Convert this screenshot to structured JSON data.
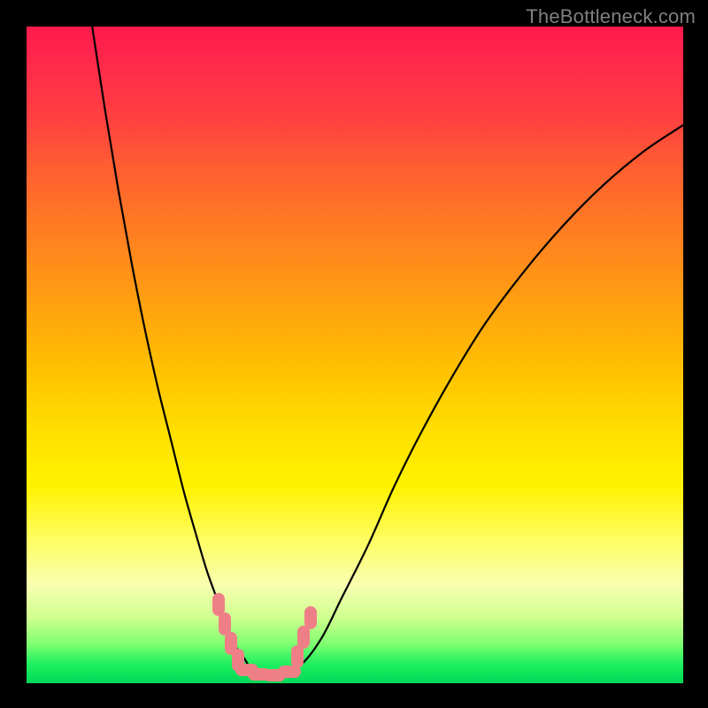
{
  "watermark": "TheBottleneck.com",
  "chart_data": {
    "type": "line",
    "title": "",
    "xlabel": "",
    "ylabel": "",
    "xlim": [
      0,
      100
    ],
    "ylim": [
      0,
      100
    ],
    "grid": false,
    "series": [
      {
        "name": "bottleneck-curve",
        "x": [
          10,
          12,
          14,
          16,
          18,
          20,
          22,
          24,
          26,
          27.5,
          29.3,
          31,
          33,
          35,
          39,
          42,
          45,
          48,
          52,
          56,
          60,
          65,
          70,
          76,
          82,
          88,
          94,
          100
        ],
        "y": [
          100,
          87,
          75,
          64,
          54,
          45,
          37,
          29,
          22,
          17,
          12,
          7,
          4,
          1.5,
          1.2,
          3,
          7,
          13,
          21,
          30,
          38,
          47,
          55,
          63,
          70,
          76,
          81,
          85
        ]
      }
    ],
    "markers": {
      "name": "highlight-region",
      "color": "#ef7f87",
      "points": [
        {
          "x": 29.3,
          "y": 12,
          "orient": "v"
        },
        {
          "x": 30.2,
          "y": 9,
          "orient": "v"
        },
        {
          "x": 31.1,
          "y": 6,
          "orient": "v"
        },
        {
          "x": 32.2,
          "y": 3.5,
          "orient": "v"
        },
        {
          "x": 33.5,
          "y": 2,
          "orient": "h"
        },
        {
          "x": 35.5,
          "y": 1.4,
          "orient": "h"
        },
        {
          "x": 37.8,
          "y": 1.2,
          "orient": "h"
        },
        {
          "x": 40.0,
          "y": 1.8,
          "orient": "h"
        },
        {
          "x": 41.2,
          "y": 4,
          "orient": "v"
        },
        {
          "x": 42.2,
          "y": 7,
          "orient": "v"
        },
        {
          "x": 43.2,
          "y": 10,
          "orient": "v"
        }
      ]
    },
    "gradient_note": "Background encodes magnitude: red(high) through yellow to green(low, bottom)."
  }
}
